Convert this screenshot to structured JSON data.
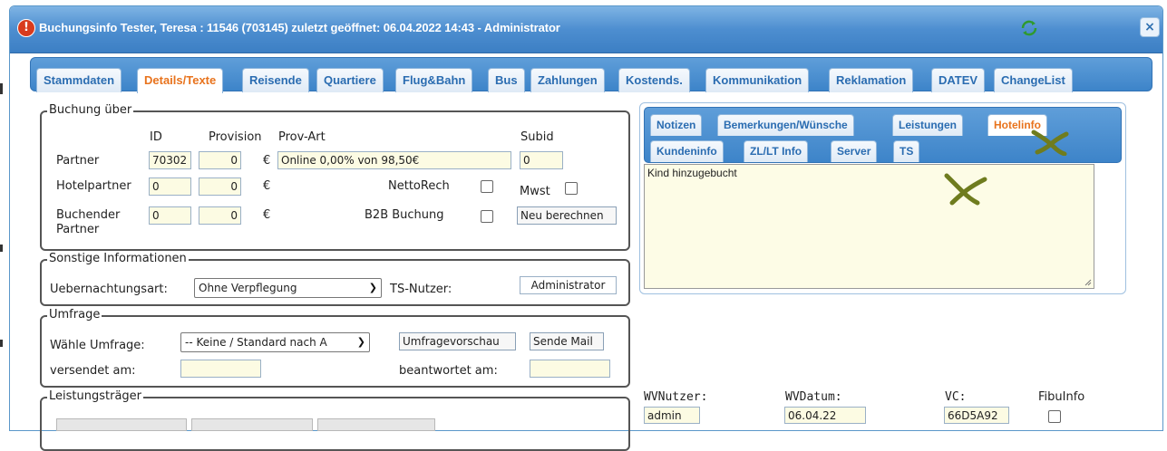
{
  "window": {
    "title": "Buchungsinfo Tester, Teresa : 11546 (703145) zuletzt geöffnet: 06.04.2022 14:43 - Administrator",
    "alert_glyph": "!",
    "close_glyph": "×"
  },
  "tabs": [
    {
      "label": "Stammdaten"
    },
    {
      "label": "Details/Texte",
      "active": true
    },
    {
      "label": "Reisende"
    },
    {
      "label": "Quartiere"
    },
    {
      "label": "Flug&Bahn"
    },
    {
      "label": "Bus"
    },
    {
      "label": "Zahlungen"
    },
    {
      "label": "Kostends."
    },
    {
      "label": "Kommunikation"
    },
    {
      "label": "Reklamation"
    },
    {
      "label": "DATEV"
    },
    {
      "label": "ChangeList"
    }
  ],
  "buchung": {
    "legend": "Buchung über",
    "col_id": "ID",
    "col_provision": "Provision",
    "col_provart": "Prov-Art",
    "col_subid": "Subid",
    "partner_label": "Partner",
    "partner_id": "70302",
    "partner_provision": "0",
    "partner_currency": "€",
    "partner_provart": "Online 0,00% von 98,50€",
    "partner_subid": "0",
    "hotelpartner_label": "Hotelpartner",
    "hotelpartner_id": "0",
    "hotelpartner_provision": "0",
    "hotelpartner_currency": "€",
    "nettorech_label": "NettoRech",
    "mwst_label": "Mwst",
    "buchender_label_1": "Buchender",
    "buchender_label_2": "Partner",
    "buchender_id": "0",
    "buchender_provision": "0",
    "buchender_currency": "€",
    "b2b_label": "B2B Buchung",
    "recalc_button": "Neu berechnen"
  },
  "sonstige": {
    "legend": "Sonstige Informationen",
    "uebernachtung_label": "Uebernachtungsart:",
    "uebernachtung_value": "Ohne Verpflegung",
    "ts_label": "TS-Nutzer:",
    "ts_value": "Administrator"
  },
  "umfrage": {
    "legend": "Umfrage",
    "waehle_label": "Wähle Umfrage:",
    "waehle_value": "-- Keine / Standard nach A",
    "preview_button": "Umfragevorschau",
    "send_button": "Sende Mail",
    "versendet_label": "versendet am:",
    "versendet_value": "",
    "beantwortet_label": "beantwortet am:",
    "beantwortet_value": ""
  },
  "leistungstraeger": {
    "legend": "Leistungsträger"
  },
  "info_panel": {
    "tabs_row1": [
      {
        "label": "Notizen"
      },
      {
        "label": "Bemerkungen/Wünsche"
      },
      {
        "label": "Leistungen"
      },
      {
        "label": "Hotelinfo",
        "active": true
      }
    ],
    "tabs_row2": [
      {
        "label": "Kundeninfo"
      },
      {
        "label": "ZL/LT Info"
      },
      {
        "label": "Server"
      },
      {
        "label": "TS"
      }
    ],
    "notes_text": "Kind hinzugebucht"
  },
  "bottom_fields": {
    "wvnutzer_label": "WVNutzer:",
    "wvnutzer_value": "admin",
    "wvdatum_label": "WVDatum:",
    "wvdatum_value": "06.04.22",
    "vc_label": "VC:",
    "vc_value": "66D5A92",
    "fibuinfo_label": "FibuInfo"
  },
  "colors": {
    "header_blue": "#4d8ed0",
    "tab_text": "#2a6cb1",
    "active_tab_text": "#e8731d",
    "field_bg": "#fcfbe3",
    "annotation_mark": "#6f7c1e"
  }
}
